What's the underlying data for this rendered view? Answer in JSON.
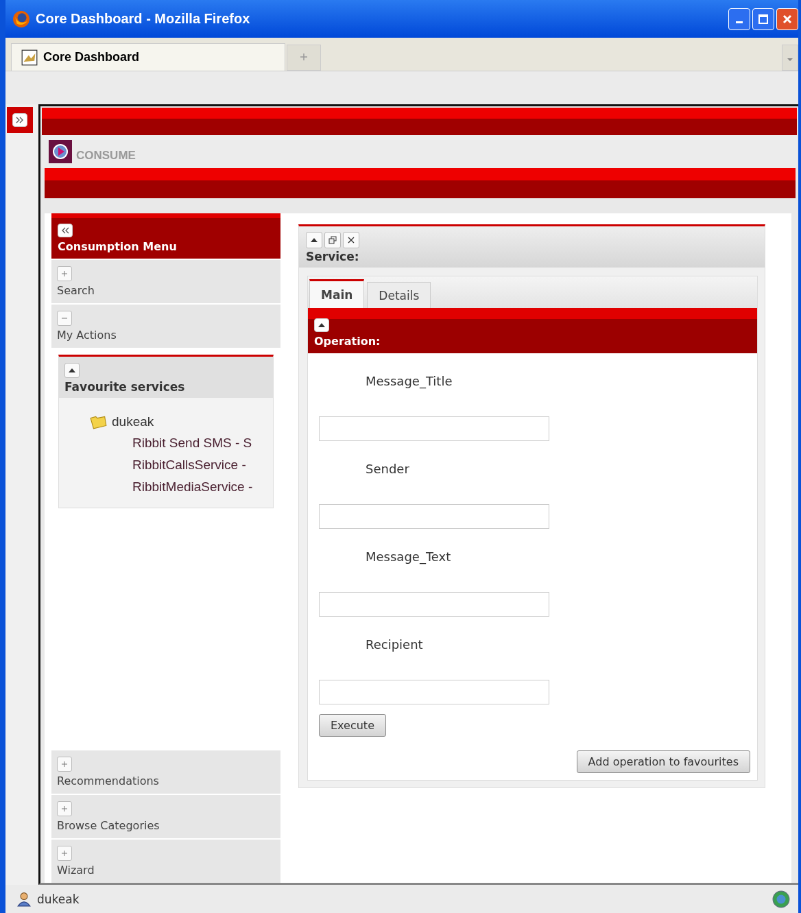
{
  "window": {
    "title": "Core Dashboard - Mozilla Firefox"
  },
  "browser_tabs": [
    {
      "label": "Core Dashboard",
      "selected": true
    }
  ],
  "app": {
    "section": "CONSUME"
  },
  "menu": {
    "title": "Consumption Menu",
    "items": [
      {
        "label": "Search",
        "expanded": false
      },
      {
        "label": "My Actions",
        "expanded": true,
        "panel": {
          "title": "Favourite services",
          "tree": [
            {
              "label": "dukeak",
              "children": [
                {
                  "label": "Ribbit Send SMS - S"
                },
                {
                  "label": "RibbitCallsService -"
                },
                {
                  "label": "RibbitMediaService -"
                }
              ]
            }
          ]
        }
      },
      {
        "label": "Recommendations",
        "expanded": false
      },
      {
        "label": "Browse Categories",
        "expanded": false
      },
      {
        "label": "Wizard",
        "expanded": false
      }
    ]
  },
  "service": {
    "title": "Service:",
    "tabs": [
      {
        "label": "Main",
        "selected": true
      },
      {
        "label": "Details",
        "selected": false
      }
    ],
    "operation": {
      "title": "Operation:",
      "fields": [
        {
          "label": "Message_Title"
        },
        {
          "label": "Sender"
        },
        {
          "label": "Message_Text"
        },
        {
          "label": "Recipient"
        }
      ],
      "execute": "Execute",
      "favourite_button": "Add operation to favourites"
    }
  },
  "status_bar": {
    "user": "dukeak"
  }
}
